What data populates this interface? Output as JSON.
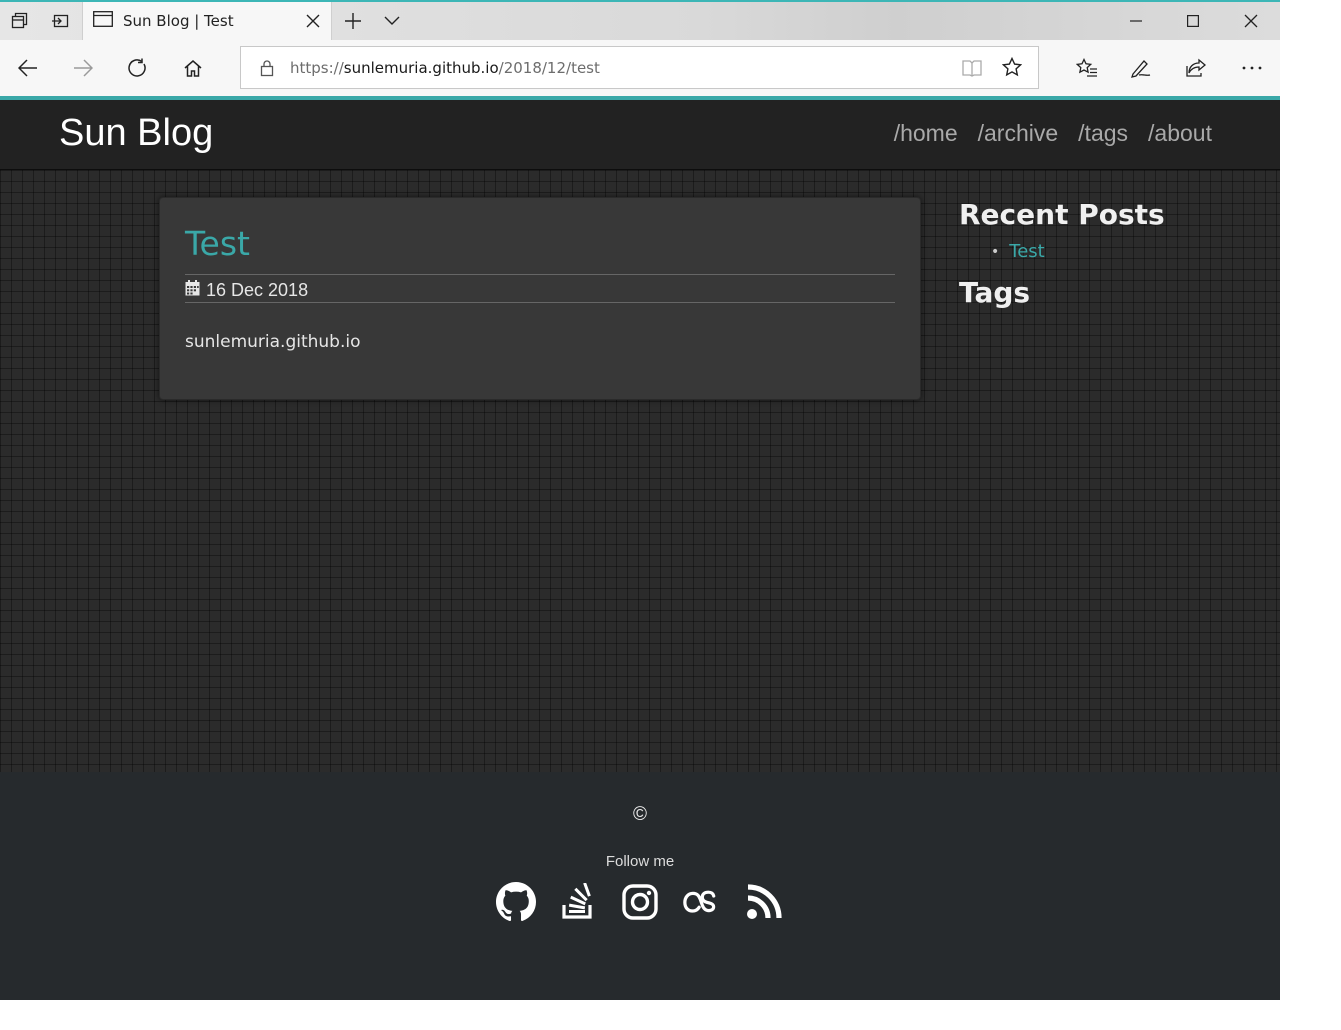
{
  "browser": {
    "tab_title": "Sun Blog | Test",
    "url_scheme": "https://",
    "url_host": "sunlemuria.github.io",
    "url_path": "/2018/12/test"
  },
  "site": {
    "brand": "Sun Blog",
    "nav": [
      "/home",
      "/archive",
      "/tags",
      "/about"
    ]
  },
  "post": {
    "title": "Test",
    "date": "16 Dec 2018",
    "body": "sunlemuria.github.io"
  },
  "sidebar": {
    "recent_heading": "Recent Posts",
    "recent_posts": [
      "Test"
    ],
    "tags_heading": "Tags"
  },
  "footer": {
    "copyright": "©",
    "follow_label": "Follow me",
    "social_icons": [
      "github-icon",
      "stackoverflow-icon",
      "instagram-icon",
      "lastfm-icon",
      "rss-icon"
    ]
  },
  "colors": {
    "accent": "#3aa8a8",
    "header_bg": "#222222",
    "footer_bg": "#262a2d"
  }
}
